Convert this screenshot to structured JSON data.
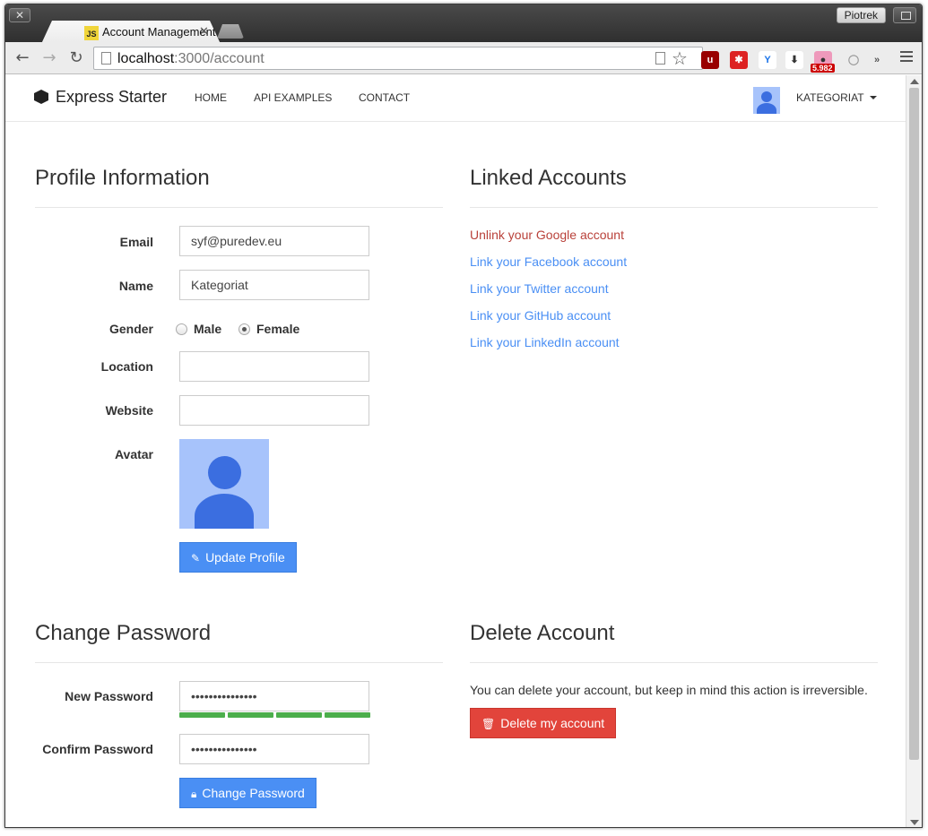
{
  "browser": {
    "tab_title": "Account Management",
    "tab_icon": "JS",
    "user": "Piotrek",
    "url_host": "localhost",
    "url_rest": ":3000/account",
    "ext_badge": "5.982"
  },
  "navbar": {
    "brand": "Express Starter",
    "links": [
      "HOME",
      "API EXAMPLES",
      "CONTACT"
    ],
    "user": "KATEGORIAT"
  },
  "profile": {
    "title": "Profile Information",
    "email_label": "Email",
    "email_value": "syf@puredev.eu",
    "name_label": "Name",
    "name_value": "Kategoriat",
    "gender_label": "Gender",
    "gender_options": [
      "Male",
      "Female"
    ],
    "gender_selected": "Female",
    "location_label": "Location",
    "location_value": "",
    "website_label": "Website",
    "website_value": "",
    "avatar_label": "Avatar",
    "update_button": "Update Profile"
  },
  "linked": {
    "title": "Linked Accounts",
    "google": "Unlink your Google account",
    "facebook": "Link your Facebook account",
    "twitter": "Link your Twitter account",
    "github": "Link your GitHub account",
    "linkedin": "Link your LinkedIn account"
  },
  "password": {
    "title": "Change Password",
    "new_label": "New Password",
    "new_value": "•••••••••••••••",
    "confirm_label": "Confirm Password",
    "confirm_value": "•••••••••••••••",
    "button": "Change Password",
    "strength_segments_filled": 4
  },
  "delete": {
    "title": "Delete Account",
    "text": "You can delete your account, but keep in mind this action is irreversible.",
    "button": "Delete my account"
  },
  "colors": {
    "primary": "#4a8ff4",
    "danger": "#e2443b",
    "success": "#4cae4c"
  }
}
